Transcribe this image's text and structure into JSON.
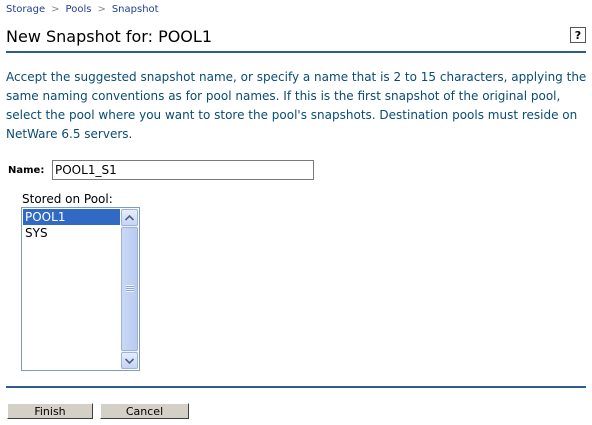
{
  "breadcrumb": [
    {
      "label": "Storage"
    },
    {
      "label": "Pools"
    },
    {
      "label": "Snapshot"
    }
  ],
  "breadcrumb_separator": ">",
  "page": {
    "title": "New Snapshot for: POOL1",
    "help_label": "?"
  },
  "description": [
    "Accept the suggested snapshot name, or specify a name that is 2 to 15 characters, applying the",
    "same naming conventions as for pool names. If this is the first snapshot of the original pool,",
    "select the pool where you want to store the pool's snapshots. Destination pools must reside on",
    "NetWare 6.5 servers."
  ],
  "form": {
    "name_label": "Name:",
    "name_value": "POOL1_S1",
    "stored_on_label": "Stored on Pool:",
    "pools": [
      {
        "label": "POOL1",
        "selected": true
      },
      {
        "label": "SYS",
        "selected": false
      }
    ]
  },
  "buttons": {
    "finish": "Finish",
    "cancel": "Cancel"
  },
  "colors": {
    "link": "#1f3f8f",
    "description_text": "#0a4b74",
    "rule": "#2e5c8e",
    "selection": "#316ac5"
  },
  "icons": {
    "scroll_up": "scroll-up-arrow-icon",
    "scroll_down": "scroll-down-arrow-icon"
  }
}
